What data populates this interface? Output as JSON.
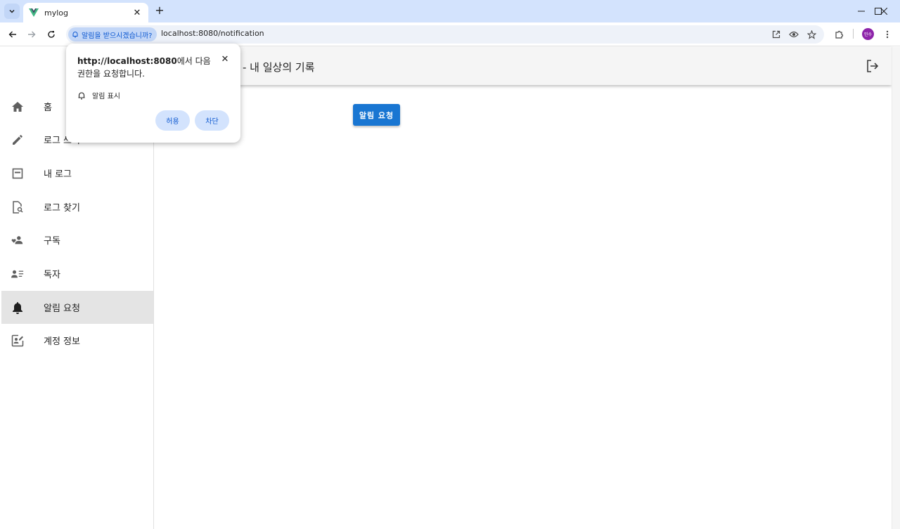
{
  "browser": {
    "tab_title": "mylog",
    "url": "localhost:8080/notification",
    "permission_chip": "알림을 받으시겠습니까?",
    "profile_initials": "민수"
  },
  "app": {
    "title": "- 내 일상의 기록",
    "request_button": "알림 요청"
  },
  "sidebar": {
    "items": [
      {
        "label": "홈",
        "icon": "home-icon"
      },
      {
        "label": "로그 쓰기",
        "icon": "pencil-icon"
      },
      {
        "label": "내 로그",
        "icon": "log-icon"
      },
      {
        "label": "로그 찾기",
        "icon": "file-search-icon"
      },
      {
        "label": "구독",
        "icon": "subscribe-icon"
      },
      {
        "label": "독자",
        "icon": "readers-icon"
      },
      {
        "label": "알림 요청",
        "icon": "bell-icon",
        "active": true
      },
      {
        "label": "계정 정보",
        "icon": "account-icon"
      }
    ]
  },
  "popup": {
    "origin": "http://localhost:8080",
    "message_suffix": "에서 다음 권한을 요청합니다.",
    "permission": "알림 표시",
    "allow": "허용",
    "block": "차단"
  },
  "colors": {
    "accent": "#1976d2",
    "tabbar": "#d3e3fd",
    "active_nav": "#e4e4e4"
  }
}
